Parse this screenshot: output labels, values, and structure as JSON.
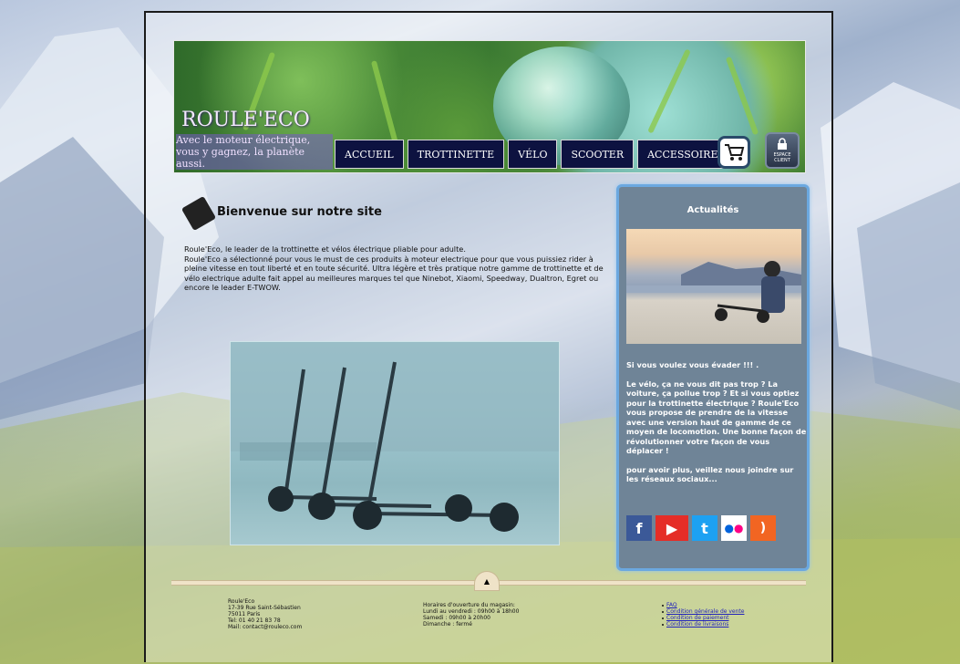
{
  "brand": {
    "name": "ROULE'ECO",
    "slogan": "Avec le moteur électrique, vous y gagnez, la planète aussi."
  },
  "nav": {
    "items": [
      "ACCUEIL",
      "TROTTINETTE",
      "VÉLO",
      "SCOOTER",
      "ACCESSOIRES"
    ],
    "cart_icon": "cart-icon",
    "espace_client_label": "ESPACE CLIENT"
  },
  "main": {
    "welcome_title": "Bienvenue sur notre site",
    "intro_line1": "Roule'Eco, le leader de la trottinette et vélos électrique pliable pour adulte.",
    "intro_line2": "Roule'Eco a sélectionné pour vous le must de ces produits à moteur electrique pour que vous puissiez rider à pleine vitesse en tout liberté et en toute sécurité. Ultra légère et très pratique notre gamme de trottinette et de vélo electrique adulte fait appel au meilleures marques tel que Ninebot, Xiaomi, Speedway, Dualtron, Egret ou encore le leader E-TWOW."
  },
  "sidebar": {
    "title": "Actualités",
    "p1": "Si vous voulez vous évader !!! .",
    "p2": "Le vélo, ça ne vous dit pas trop ? La voiture, ça pollue trop ? Et si vous optiez pour la trottinette électrique ? Roule'Eco vous propose de prendre de la vitesse avec une version haut de gamme de ce moyen de locomotion. Une bonne façon de révolutionner votre façon de vous déplacer !",
    "p3": "pour avoir plus, veillez nous joindre sur les réseaux sociaux...",
    "socials": [
      {
        "name": "facebook-icon",
        "glyph": "f",
        "color": "#3b5998"
      },
      {
        "name": "youtube-icon",
        "glyph": "▶",
        "color": "#e52d27"
      },
      {
        "name": "twitter-icon",
        "glyph": "t",
        "color": "#1da1f2"
      },
      {
        "name": "flickr-icon",
        "glyph": "••",
        "color": "#ffffff"
      },
      {
        "name": "rss-icon",
        "glyph": "⟆",
        "color": "#f26522"
      }
    ]
  },
  "footer": {
    "address": [
      "Roule'Eco",
      "17-39 Rue Saint-Sébastien",
      "75011 Paris",
      "Tel: 01 40 21 83 78",
      "Mail: contact@rouleco.com"
    ],
    "hours": [
      "Horaires d'ouverture du magasin:",
      "Lundi au vendredi : 09h00 à 18h00",
      "Samedi : 09h00 à 20h00",
      "Dimanche : fermé"
    ],
    "links": [
      "FAQ",
      "Condition générale de vente",
      "Condition de paiement",
      "Condition de livraisons"
    ]
  }
}
